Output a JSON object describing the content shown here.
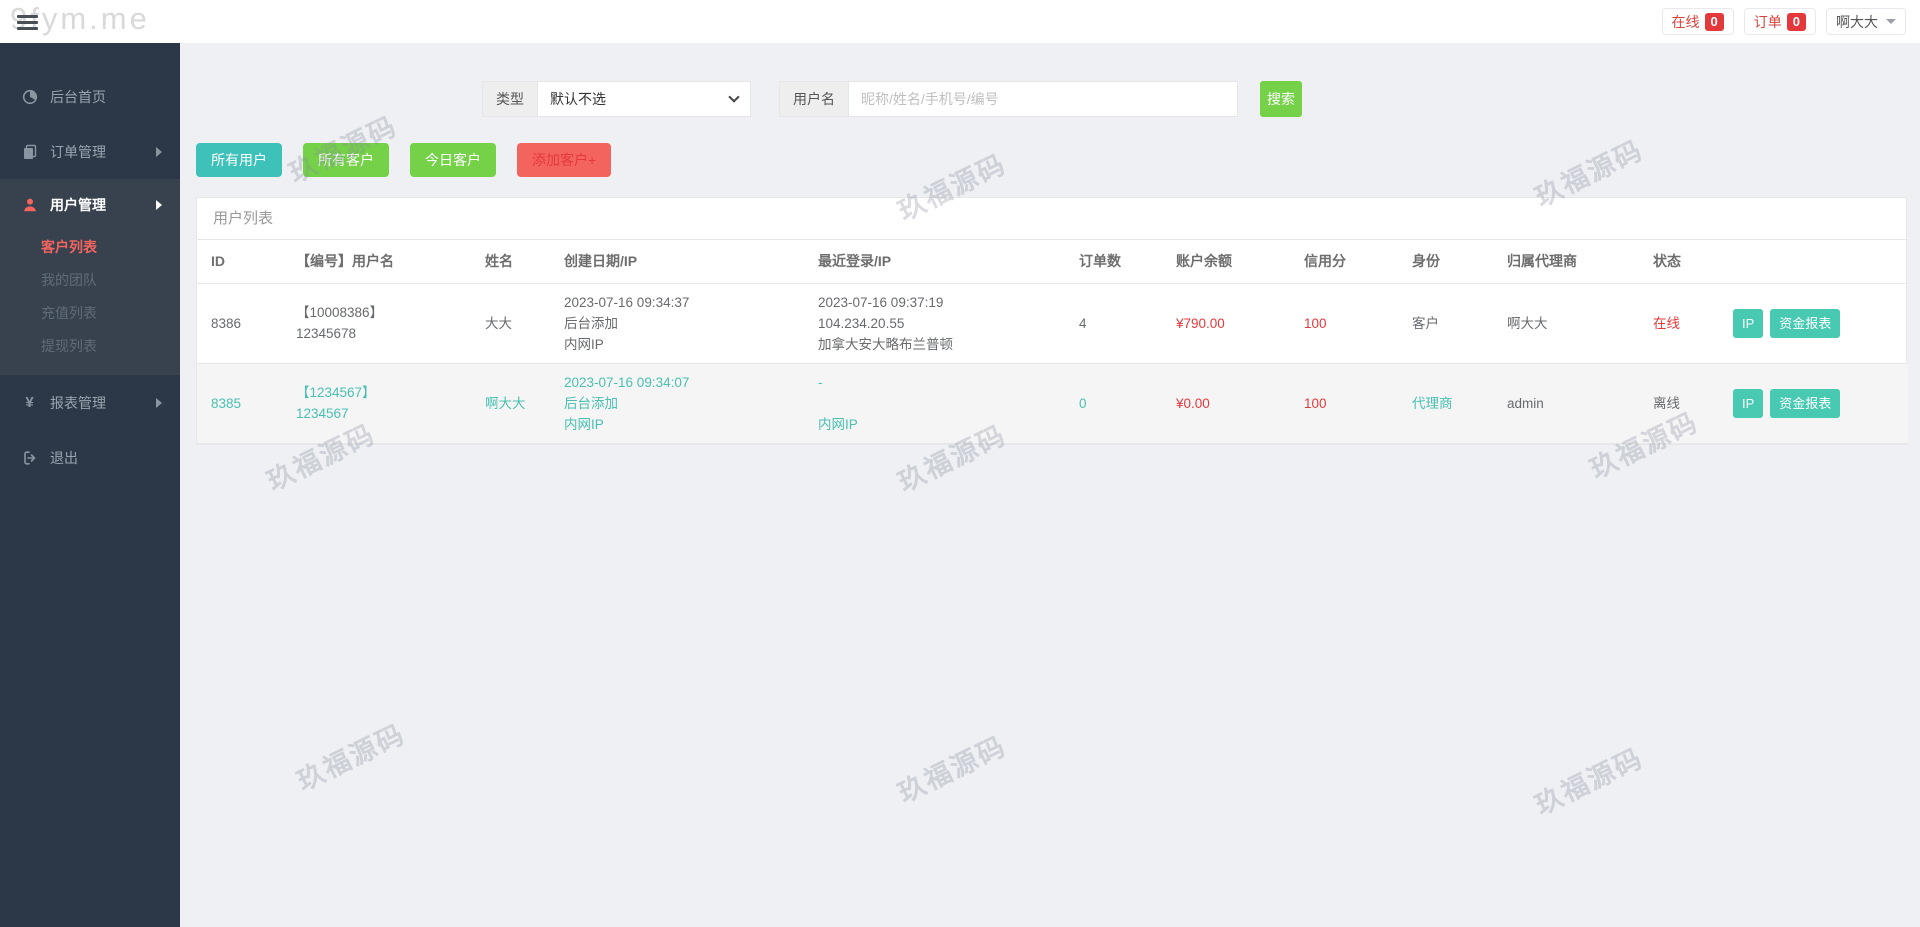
{
  "watermarks": {
    "brand": "9fym.me",
    "tile": "玖福源码"
  },
  "topbar": {
    "online_label": "在线",
    "online_count": "0",
    "order_label": "订单",
    "order_count": "0",
    "user_name": "啊大大"
  },
  "sidebar": {
    "dashboard": "后台首页",
    "orders": "订单管理",
    "users": "用户管理",
    "reports": "报表管理",
    "logout": "退出",
    "submenu": {
      "customers": "客户列表",
      "team": "我的团队",
      "recharge": "充值列表",
      "withdraw": "提现列表"
    }
  },
  "filters": {
    "type_label": "类型",
    "type_value": "默认不选",
    "username_label": "用户名",
    "username_placeholder": "昵称/姓名/手机号/编号",
    "search_label": "搜索"
  },
  "action_buttons": {
    "all_users": "所有用户",
    "all_customers": "所有客户",
    "today_customers": "今日客户",
    "add_customer": "添加客户+"
  },
  "table": {
    "title": "用户列表",
    "columns": [
      "ID",
      "【编号】用户名",
      "姓名",
      "创建日期/IP",
      "最近登录/IP",
      "订单数",
      "账户余额",
      "信用分",
      "身份",
      "归属代理商",
      "状态",
      ""
    ],
    "rows": [
      {
        "id": "8386",
        "code": "【10008386】",
        "username": "12345678",
        "name": "大大",
        "created": [
          "2023-07-16 09:34:37",
          "后台添加",
          "内网IP"
        ],
        "last_login": [
          "2023-07-16 09:37:19",
          "104.234.20.55",
          "加拿大安大略布兰普顿"
        ],
        "orders": "4",
        "balance": "¥790.00",
        "credit": "100",
        "role": "客户",
        "agent": "啊大大",
        "status": "在线",
        "status_online": true,
        "theme": "normal",
        "buttons": [
          "IP",
          "资金报表"
        ]
      },
      {
        "id": "8385",
        "code": "【1234567】",
        "username": "1234567",
        "name": "啊大大",
        "created": [
          "2023-07-16 09:34:07",
          "后台添加",
          "内网IP"
        ],
        "last_login": [
          "-",
          "",
          "内网IP"
        ],
        "orders": "0",
        "balance": "¥0.00",
        "credit": "100",
        "role": "代理商",
        "agent": "admin",
        "status": "离线",
        "status_online": false,
        "theme": "teal",
        "buttons": [
          "IP",
          "资金报表"
        ]
      }
    ]
  },
  "colors": {
    "teal_button": "#3dc1b8",
    "small_teal_button": "#47c9b2",
    "green_button": "#74d148",
    "red_button": "#f4645f",
    "value_red": "#e4393c",
    "teal_text": "#4ac0b0",
    "badge_red": "#e4393c",
    "sidebar_bg": "#2c3847",
    "sidebar_active_bg": "#38424f"
  }
}
